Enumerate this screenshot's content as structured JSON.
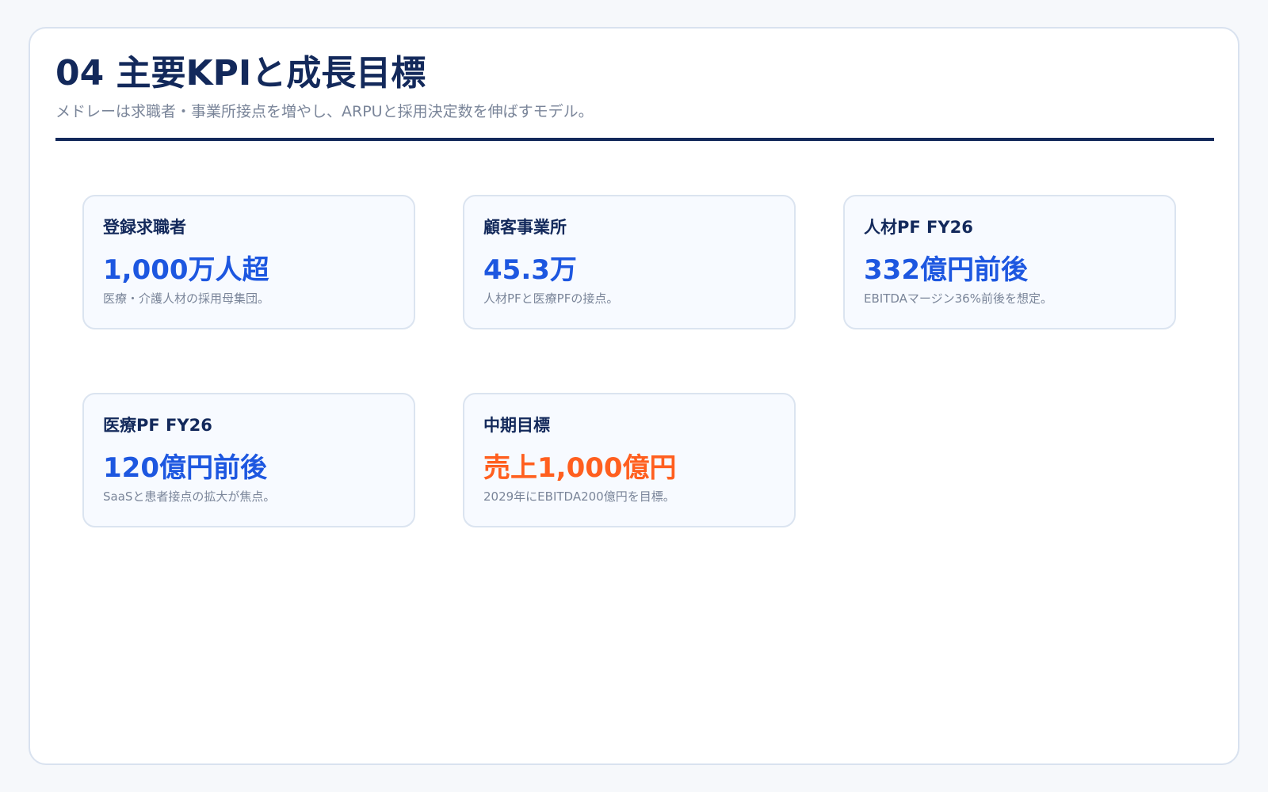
{
  "slide": {
    "title": "04 主要KPIと成長目標",
    "subtitle": "メドレーは求職者・事業所接点を増やし、ARPUと採用決定数を伸ばすモデル。"
  },
  "kpis": [
    {
      "label": "登録求職者",
      "value": "1,000万人超",
      "note": "医療・介護人材の採用母集団。",
      "color": "#1d57e0"
    },
    {
      "label": "顧客事業所",
      "value": "45.3万",
      "note": "人材PFと医療PFの接点。",
      "color": "#1d57e0"
    },
    {
      "label": "人材PF FY26",
      "value": "332億円前後",
      "note": "EBITDAマージン36%前後を想定。",
      "color": "#1d57e0"
    },
    {
      "label": "医療PF FY26",
      "value": "120億円前後",
      "note": "SaaSと患者接点の拡大が焦点。",
      "color": "#1d57e0"
    },
    {
      "label": "中期目標",
      "value": "売上1,000億円",
      "note": "2029年にEBITDA200億円を目標。",
      "color": "#ff5f1f"
    }
  ],
  "colors": {
    "navy": "#13295b",
    "blue": "#1d57e0",
    "orange": "#ff5f1f",
    "muted": "#7a8599"
  }
}
